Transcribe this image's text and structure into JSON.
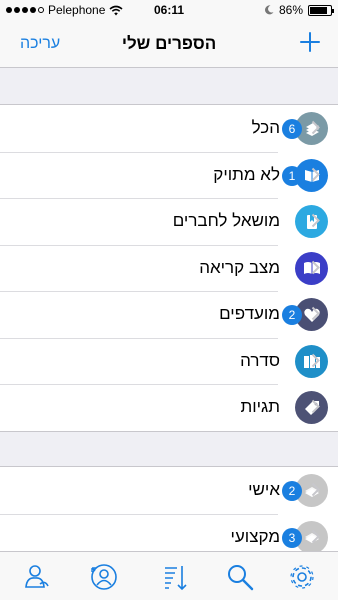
{
  "status_bar": {
    "carrier": "Pelephone",
    "time": "06:11",
    "battery": "86%",
    "battery_level": 0.86
  },
  "nav": {
    "title": "הספרים שלי",
    "edit_label": "עריכה",
    "add_icon": "plus-icon"
  },
  "library": [
    {
      "label": "הכל",
      "badge": "6",
      "icon": "books-stack-icon",
      "color": "#7b9aa6"
    },
    {
      "label": "לא מתויק",
      "badge": "1",
      "icon": "open-book-icon",
      "color": "#1a7fe0"
    },
    {
      "label": "מושאל לחברים",
      "badge": "",
      "icon": "lent-book-icon",
      "color": "#2ca9e1"
    },
    {
      "label": "מצב קריאה",
      "badge": "",
      "icon": "reading-book-icon",
      "color": "#3b3ec7"
    },
    {
      "label": "מועדפים",
      "badge": "2",
      "icon": "heart-icon",
      "color": "#4a4f74"
    },
    {
      "label": "סדרה",
      "badge": "",
      "icon": "series-books-icon",
      "color": "#1f8fc8"
    },
    {
      "label": "תגיות",
      "badge": "",
      "icon": "tag-icon",
      "color": "#4d5275"
    }
  ],
  "shelves": [
    {
      "label": "אישי",
      "badge": "2",
      "icon": "book-gray-icon",
      "color": "#c6c6c6"
    },
    {
      "label": "מקצועי",
      "badge": "3",
      "icon": "book-gray-icon",
      "color": "#c6c6c6"
    }
  ],
  "tabs": [
    {
      "name": "users-icon"
    },
    {
      "name": "contacts-icon"
    },
    {
      "name": "sort-icon"
    },
    {
      "name": "search-icon"
    },
    {
      "name": "gear-icon"
    }
  ]
}
